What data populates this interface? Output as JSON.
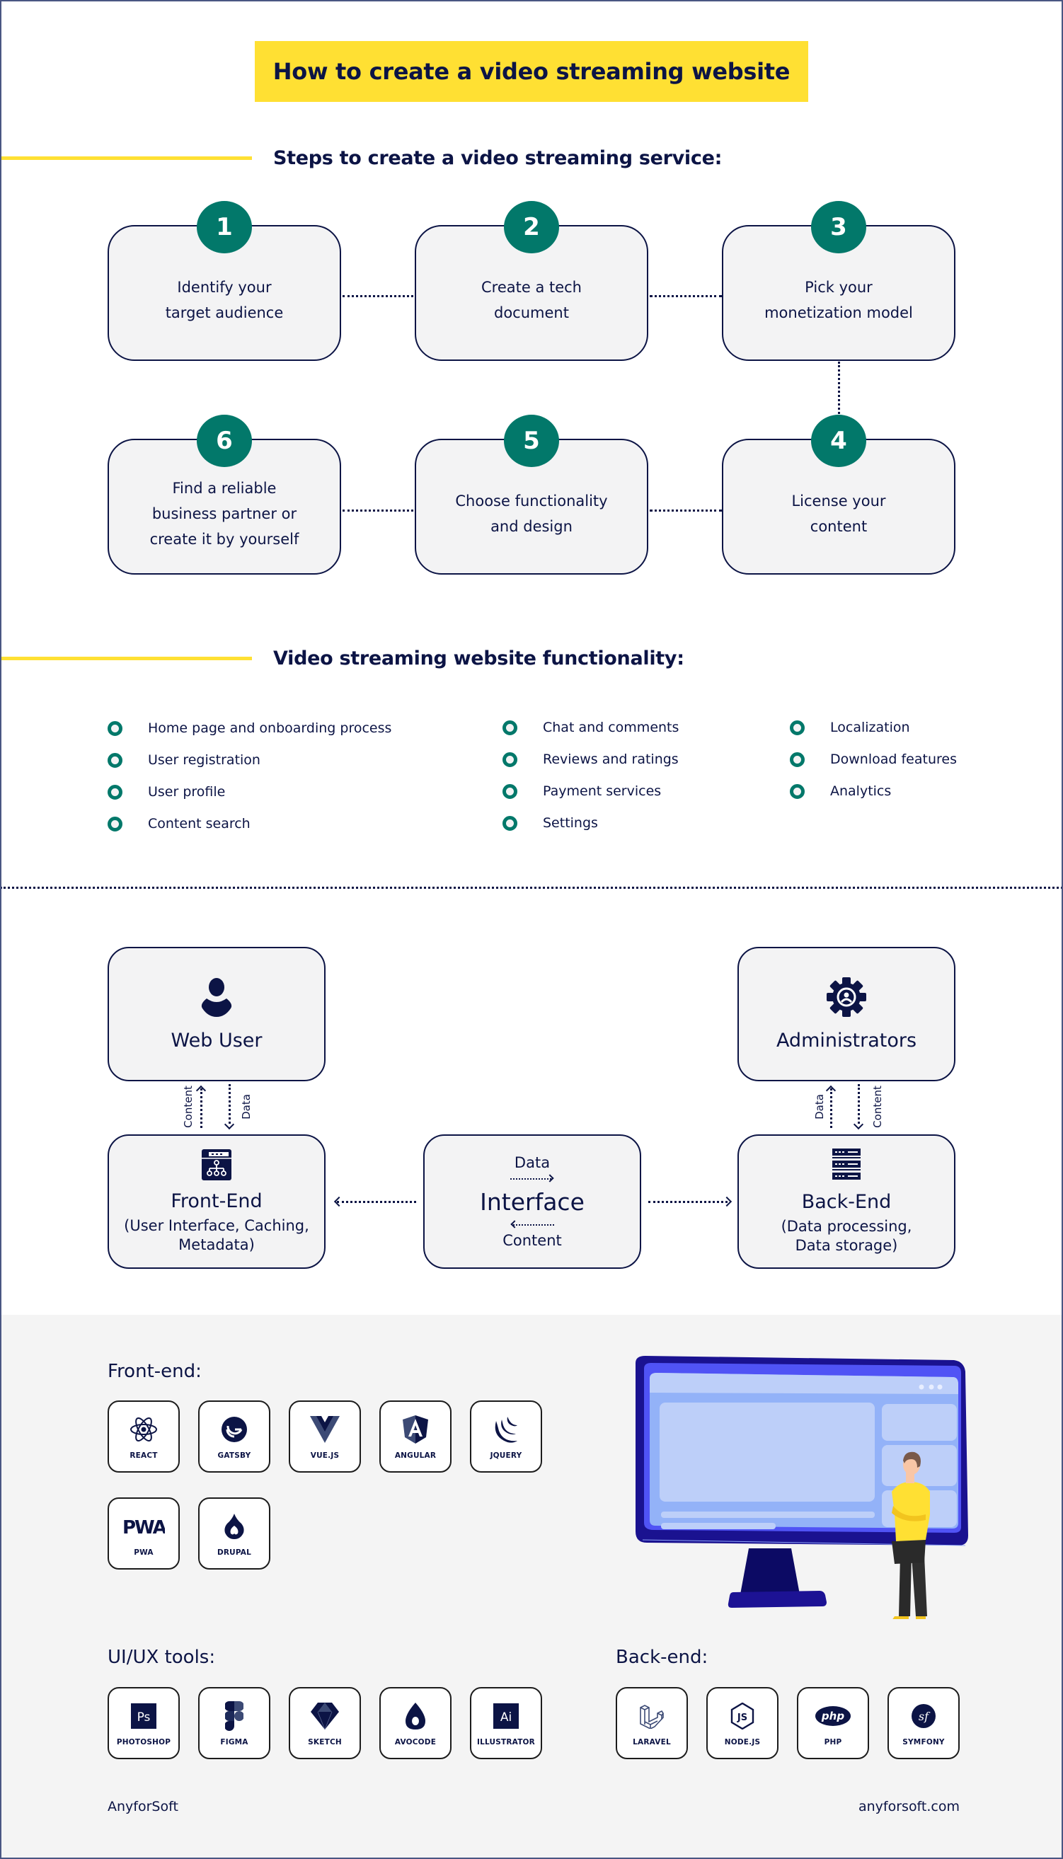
{
  "title": "How to create a video streaming website",
  "steps_section": {
    "heading": "Steps to create a video streaming service:",
    "steps": [
      {
        "number": "1",
        "label_lines": [
          "Identify your",
          "target audience"
        ]
      },
      {
        "number": "2",
        "label_lines": [
          "Create a tech",
          "document"
        ]
      },
      {
        "number": "3",
        "label_lines": [
          "Pick your",
          "monetization model"
        ]
      },
      {
        "number": "4",
        "label_lines": [
          "License your",
          "content"
        ]
      },
      {
        "number": "5",
        "label_lines": [
          "Choose functionality",
          "and design"
        ]
      },
      {
        "number": "6",
        "label_lines": [
          "Find a reliable",
          "business partner or",
          "create it by yourself"
        ]
      }
    ]
  },
  "functionality_section": {
    "heading": "Video streaming website functionality:",
    "columns": [
      [
        "Home page and onboarding process",
        "User registration",
        "User profile",
        "Content search"
      ],
      [
        "Chat and comments",
        "Reviews and  ratings",
        "Payment services",
        "Settings"
      ],
      [
        "Localization",
        "Download features",
        "Analytics"
      ]
    ]
  },
  "architecture": {
    "web_user": {
      "title": "Web User",
      "icon": "user-icon"
    },
    "administrators": {
      "title": "Administrators",
      "icon": "gear-user-icon"
    },
    "front_end": {
      "title": "Front-End",
      "subtitle_lines": [
        "(User Interface, Caching,",
        "Metadata)"
      ],
      "icon": "sitemap-window-icon"
    },
    "back_end": {
      "title": "Back-End",
      "subtitle_lines": [
        "(Data processing,",
        "Data storage)"
      ],
      "icon": "server-icon"
    },
    "interface": {
      "title": "Interface",
      "top_label": "Data",
      "bottom_label": "Content"
    },
    "left_link_labels": {
      "up": "Content",
      "down": "Data"
    },
    "right_link_labels": {
      "up": "Data",
      "down": "Content"
    }
  },
  "tech_stack": {
    "front_end": {
      "heading": "Front-end:",
      "items": [
        {
          "name": "REACT",
          "icon": "react-icon"
        },
        {
          "name": "GATSBY",
          "icon": "gatsby-icon"
        },
        {
          "name": "VUE.JS",
          "icon": "vue-icon"
        },
        {
          "name": "ANGULAR",
          "icon": "angular-icon"
        },
        {
          "name": "JQUERY",
          "icon": "jquery-icon"
        },
        {
          "name": "PWA",
          "icon": "pwa-icon"
        },
        {
          "name": "DRUPAL",
          "icon": "drupal-icon"
        }
      ]
    },
    "ui_ux": {
      "heading": "UI/UX tools:",
      "items": [
        {
          "name": "PHOTOSHOP",
          "icon": "photoshop-icon",
          "glyph": "Ps"
        },
        {
          "name": "FIGMA",
          "icon": "figma-icon"
        },
        {
          "name": "SKETCH",
          "icon": "sketch-icon"
        },
        {
          "name": "AVOCODE",
          "icon": "avocode-icon"
        },
        {
          "name": "ILLUSTRATOR",
          "icon": "illustrator-icon",
          "glyph": "Ai"
        }
      ]
    },
    "back_end": {
      "heading": "Back-end:",
      "items": [
        {
          "name": "LARAVEL",
          "icon": "laravel-icon"
        },
        {
          "name": "NODE.JS",
          "icon": "nodejs-icon"
        },
        {
          "name": "PHP",
          "icon": "php-icon",
          "glyph": "php"
        },
        {
          "name": "SYMFONY",
          "icon": "symfony-icon",
          "glyph": "sf"
        }
      ]
    }
  },
  "footer": {
    "brand": "AnyforSoft",
    "url": "anyforsoft.com"
  },
  "colors": {
    "accent_yellow": "#ffe033",
    "teal": "#02786a",
    "navy": "#0c1445",
    "box_fill": "#f3f3f4",
    "grey_bg": "#f4f4f4"
  }
}
